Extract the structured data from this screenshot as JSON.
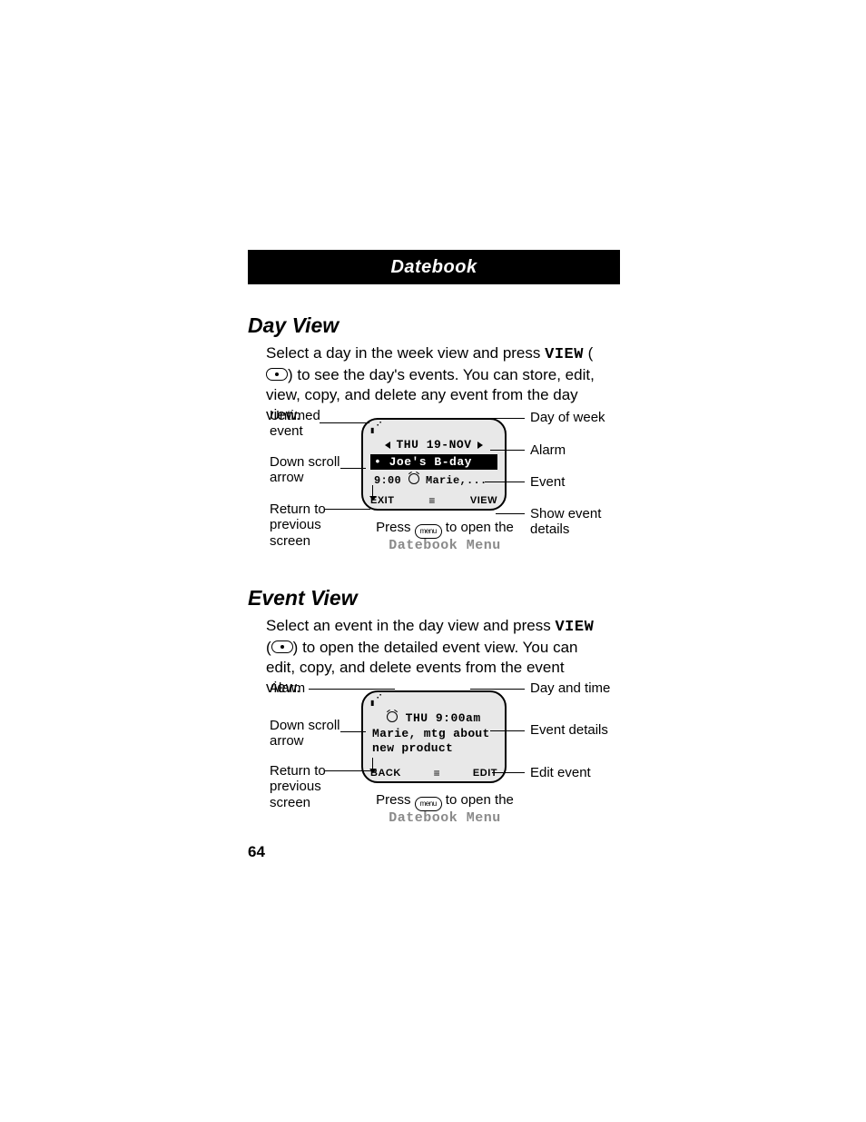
{
  "header": {
    "title": "Datebook"
  },
  "page_number": "64",
  "day_view": {
    "title": "Day View",
    "intro_1": "Select a day in the week view and press ",
    "view_key": "VIEW",
    "intro_2": " to see the day's events. You can store, edit, view, copy, and delete any event from the day view.",
    "screen": {
      "date_header": "THU 19-NOV",
      "event_highlight": "• Joe's B-day",
      "event_time": "9:00",
      "event_name": "Marie,...",
      "soft_left": "EXIT",
      "soft_right": "VIEW"
    },
    "callouts": {
      "untimed_event": "Untimed event",
      "down_scroll": "Down scroll arrow",
      "return_prev": "Return to previous screen",
      "day_of_week": "Day of week",
      "alarm": "Alarm",
      "event": "Event",
      "show_details": "Show event details"
    },
    "caption_1": "Press ",
    "caption_2": " to open the ",
    "menu_name": "Datebook Menu",
    "menu_label": "menu"
  },
  "event_view": {
    "title": "Event View",
    "intro_1": "Select an event in the day view and press ",
    "view_key": "VIEW",
    "intro_2": " to open the detailed event view. You can edit, copy, and delete events from the event view.",
    "screen": {
      "header": "THU 9:00am",
      "body_line1": "Marie, mtg about",
      "body_line2": "new product",
      "soft_left": "BACK",
      "soft_right": "EDIT"
    },
    "callouts": {
      "alarm": "Alarm",
      "down_scroll": "Down scroll arrow",
      "return_prev": "Return to previous screen",
      "day_time": "Day and time",
      "event_details": "Event details",
      "edit_event": "Edit event"
    },
    "caption_1": "Press ",
    "caption_2": " to open the ",
    "menu_name": "Datebook Menu",
    "menu_label": "menu"
  }
}
